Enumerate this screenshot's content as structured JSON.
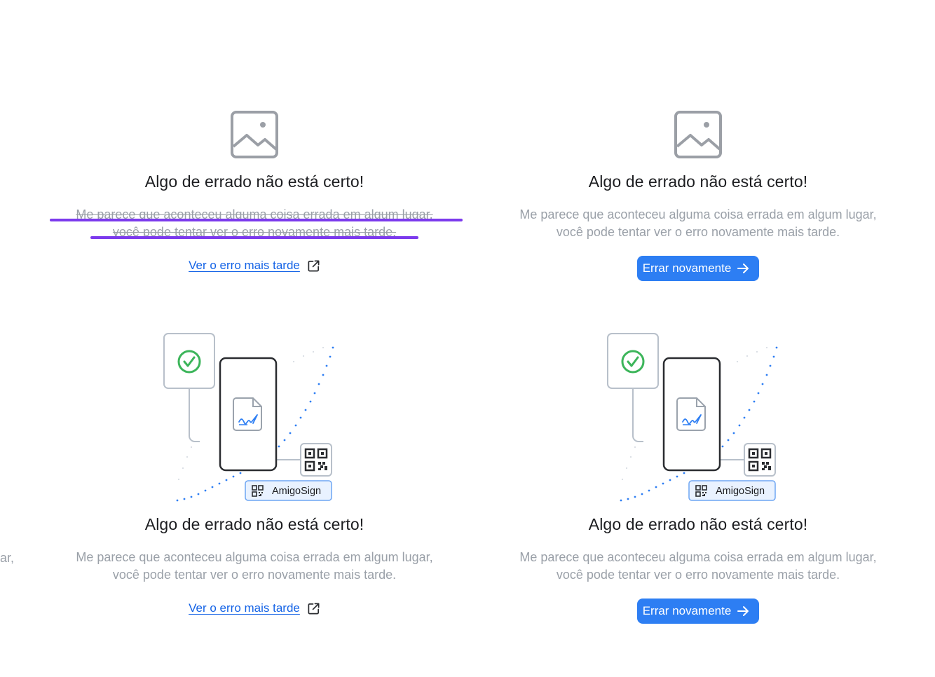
{
  "error_state": {
    "title": "Algo de errado não está certo!",
    "description_line1": "Me parece que aconteceu alguma coisa errada em algum lugar,",
    "description_line2": "você pode tentar ver o erro novamente mais tarde.",
    "link_label": "Ver o erro mais tarde",
    "button_label": "Errar novamente",
    "brand_label": "AmigoSign"
  },
  "edge_fragment": "ar,",
  "colors": {
    "title": "#1c1d20",
    "muted_text": "#9aa0a8",
    "link": "#1463e6",
    "button": "#2d7ef3",
    "highlight": "#7c3aed",
    "success": "#3cb55a"
  },
  "icons": [
    "image-placeholder-icon",
    "external-link-icon",
    "arrow-right-icon",
    "check-circle-icon",
    "qr-code-icon",
    "signed-document-icon"
  ]
}
